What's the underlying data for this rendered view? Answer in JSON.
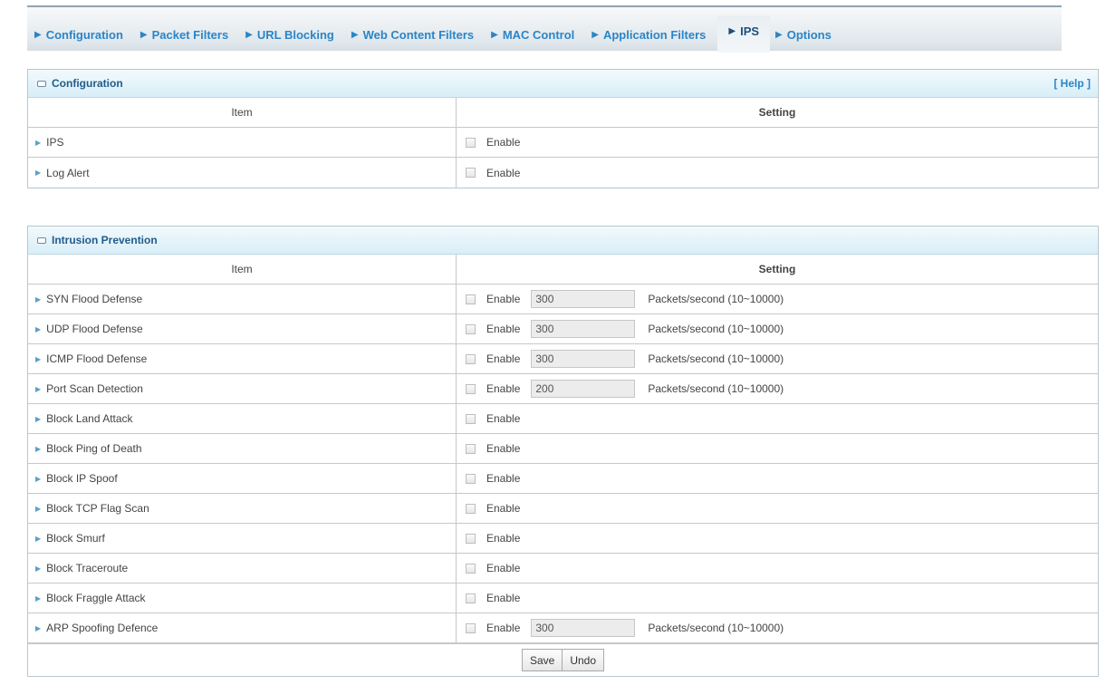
{
  "tabs": [
    {
      "label": "Configuration",
      "active": false
    },
    {
      "label": "Packet Filters",
      "active": false
    },
    {
      "label": "URL Blocking",
      "active": false
    },
    {
      "label": "Web Content Filters",
      "active": false
    },
    {
      "label": "MAC Control",
      "active": false
    },
    {
      "label": "Application Filters",
      "active": false
    },
    {
      "label": "IPS",
      "active": true
    },
    {
      "label": "Options",
      "active": false
    }
  ],
  "configuration": {
    "title": "Configuration",
    "help": "[ Help ]",
    "col_item": "Item",
    "col_setting": "Setting",
    "rows": [
      {
        "item": "IPS",
        "enable": "Enable"
      },
      {
        "item": "Log Alert",
        "enable": "Enable"
      }
    ]
  },
  "intrusion": {
    "title": "Intrusion Prevention",
    "col_item": "Item",
    "col_setting": "Setting",
    "rows": [
      {
        "item": "SYN Flood Defense",
        "enable": "Enable",
        "value": "300",
        "unit": "Packets/second (10~10000)"
      },
      {
        "item": "UDP Flood Defense",
        "enable": "Enable",
        "value": "300",
        "unit": "Packets/second (10~10000)"
      },
      {
        "item": "ICMP Flood Defense",
        "enable": "Enable",
        "value": "300",
        "unit": "Packets/second (10~10000)"
      },
      {
        "item": "Port Scan Detection",
        "enable": "Enable",
        "value": "200",
        "unit": "Packets/second (10~10000)"
      },
      {
        "item": "Block Land Attack",
        "enable": "Enable"
      },
      {
        "item": "Block Ping of Death",
        "enable": "Enable"
      },
      {
        "item": "Block IP Spoof",
        "enable": "Enable"
      },
      {
        "item": "Block TCP Flag Scan",
        "enable": "Enable"
      },
      {
        "item": "Block Smurf",
        "enable": "Enable"
      },
      {
        "item": "Block Traceroute",
        "enable": "Enable"
      },
      {
        "item": "Block Fraggle Attack",
        "enable": "Enable"
      },
      {
        "item": "ARP Spoofing Defence",
        "enable": "Enable",
        "value": "300",
        "unit": "Packets/second (10~10000)"
      }
    ],
    "save": "Save",
    "undo": "Undo"
  }
}
